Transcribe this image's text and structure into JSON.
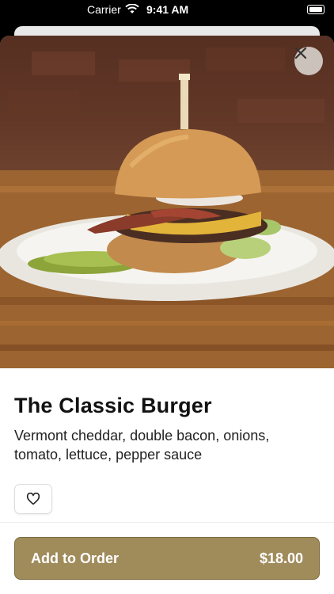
{
  "status_bar": {
    "carrier": "Carrier",
    "time": "9:41 AM"
  },
  "item": {
    "title": "The Classic Burger",
    "description": "Vermont cheddar, double bacon, onions, tomato, lettuce, pepper sauce"
  },
  "cta": {
    "label": "Add to Order",
    "price": "$18.00"
  },
  "icons": {
    "close": "close-icon",
    "favorite": "heart-icon"
  },
  "colors": {
    "accent": "#a08b5b",
    "accent_border": "#7d6b3f"
  }
}
